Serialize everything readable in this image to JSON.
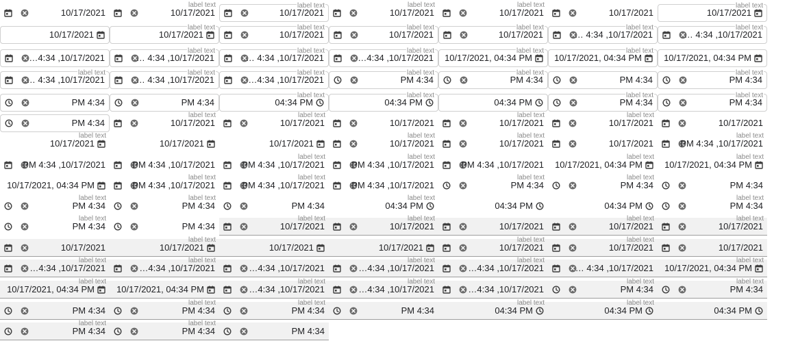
{
  "window": {
    "title": ""
  },
  "label_text": "label text",
  "values": {
    "date": "10/17/2021",
    "time_ltr": "04:34 PM",
    "time_rtl": "PM 4:34",
    "datetime_ltr": "10/17/2021, 04:34 PM",
    "datetime_rtl": "PM 4:34 ,10/17/2021",
    "datetime_trunc": "…4:34 ,10/17/2021",
    "datetime_trunc2": "… 4:34 ,10/17/2021"
  },
  "icons": {
    "calendar": "calendar-icon",
    "clock": "clock-icon",
    "clear": "clear-icon"
  },
  "colors": {
    "outline": "#cfcfcf",
    "fill": "#f1f1f1",
    "label": "#8a8a8a",
    "icon": "#3c3c3c"
  }
}
